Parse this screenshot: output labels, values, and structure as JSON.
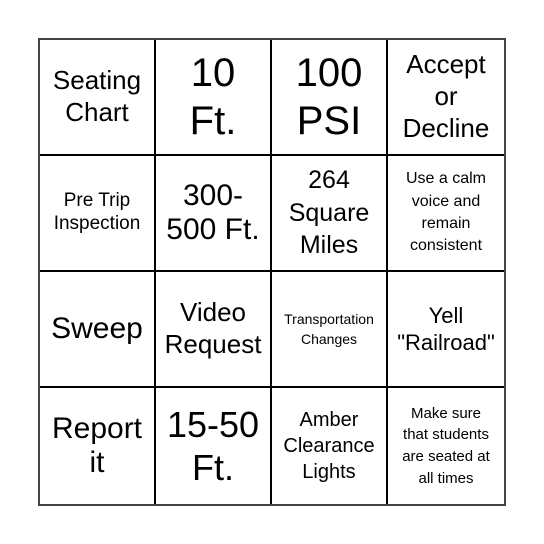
{
  "board": {
    "rows": [
      [
        "Seating Chart",
        "10 Ft.",
        "100 PSI",
        "Accept or Decline"
      ],
      [
        "Pre Trip Inspection",
        "300-500 Ft.",
        "264 Square Miles",
        "Use a calm voice and remain consistent"
      ],
      [
        "Sweep",
        "Video Request",
        "Transportation Changes",
        "Yell \"Railroad\""
      ],
      [
        "Report it",
        "15-50 Ft.",
        "Amber Clearance Lights",
        "Make sure that students are seated at all times"
      ]
    ],
    "display_lines": [
      [
        "Seating\nChart",
        "10\nFt.",
        "100\nPSI",
        "Accept\nor\nDecline"
      ],
      [
        "Pre Trip\nInspection",
        "300-\n500 Ft.",
        "264\nSquare\nMiles",
        "Use a calm\nvoice and\nremain\nconsistent"
      ],
      [
        "Sweep",
        "Video\nRequest",
        "Transportation\nChanges",
        "Yell\n\"Railroad\""
      ],
      [
        "Report\nit",
        "15-50\nFt.",
        "Amber\nClearance\nLights",
        "Make sure\nthat students\nare seated at\nall times"
      ]
    ]
  },
  "colors": {
    "border_outer": "#444444",
    "grid_lines": "#000000",
    "text": "#000000",
    "background": "#ffffff"
  }
}
